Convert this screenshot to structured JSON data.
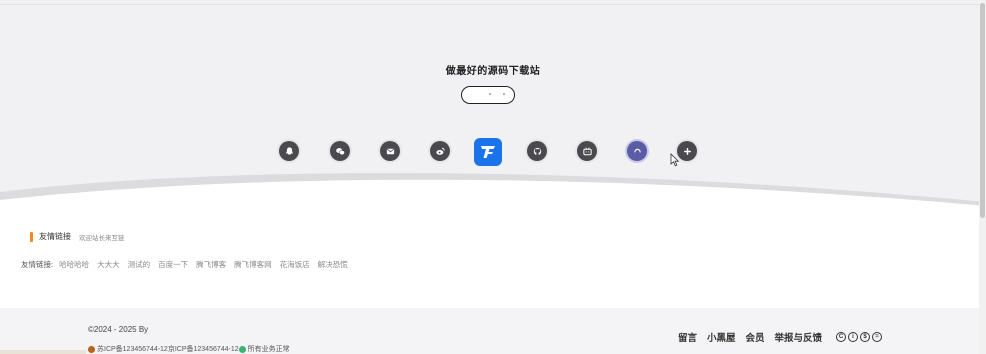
{
  "hero": {
    "site_title": "做最好的源码下载站"
  },
  "social_icons": [
    {
      "name": "qq-icon",
      "glyph": "qq"
    },
    {
      "name": "wechat-icon",
      "glyph": "wechat"
    },
    {
      "name": "email-icon",
      "glyph": "email"
    },
    {
      "name": "weibo-icon",
      "glyph": "weibo"
    },
    {
      "name": "site-logo-icon",
      "glyph": "logo"
    },
    {
      "name": "github-icon",
      "glyph": "github"
    },
    {
      "name": "bilibili-icon",
      "glyph": "bilibili"
    },
    {
      "name": "home-circle-icon",
      "glyph": "home"
    },
    {
      "name": "add-icon",
      "glyph": "plus"
    }
  ],
  "friend_links": {
    "heading": "友情链接",
    "subheading": "欢迎站长来互链",
    "row_label": "友情链接:",
    "links": [
      "哈哈哈哈",
      "大大大",
      "测试的",
      "百度一下",
      "腾飞博客",
      "腾飞博客网",
      "花海饭店",
      "解决恐慌"
    ]
  },
  "footer": {
    "copyright": "©2024 - 2025 By",
    "icp_1": "苏ICP备123456744-12",
    "icp_2": "京ICP备123456744-12",
    "status": "所有业务正常",
    "nav": [
      "留言",
      "小黑屋",
      "会员",
      "举报与反馈"
    ],
    "license_badges": [
      "C",
      "i",
      "$",
      "="
    ]
  },
  "colors": {
    "hero_bg": "#f1f1f3",
    "featured_icon": "#1a73e8",
    "accent_bar": "#f08c1c",
    "footer_bg": "#f4f4f6"
  }
}
